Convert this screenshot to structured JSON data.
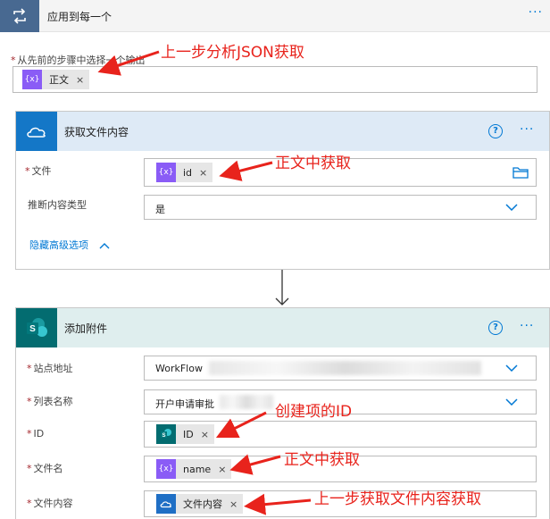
{
  "loop": {
    "title": "应用到每一个",
    "more": "···",
    "select_label": "从先前的步骤中选择一个输出",
    "token": "正文"
  },
  "card1": {
    "title": "获取文件内容",
    "help": "?",
    "more": "···",
    "file_label": "文件",
    "file_token": "id",
    "infer_label": "推断内容类型",
    "infer_value": "是",
    "advanced_link": "隐藏高级选项"
  },
  "card2": {
    "title": "添加附件",
    "help": "?",
    "more": "···",
    "site_label": "站点地址",
    "site_value": "WorkFlow",
    "list_label": "列表名称",
    "list_value": "开户申请审批",
    "id_label": "ID",
    "id_token": "ID",
    "filename_label": "文件名",
    "filename_token": "name",
    "content_label": "文件内容",
    "content_token": "文件内容"
  },
  "annotations": {
    "a1": "上一步分析JSON获取",
    "a2": "正文中获取",
    "a3": "创建项的ID",
    "a4": "正文中获取",
    "a5": "上一步获取文件内容获取"
  },
  "common": {
    "required_mark": "*",
    "remove": "×",
    "expr_glyph": "{x}"
  },
  "colors": {
    "loop_header": "#486991",
    "onedrive_header": "#deeaf6",
    "sharepoint_header": "#dfeeee",
    "link": "#0078d4",
    "annotation": "#e8231c"
  }
}
